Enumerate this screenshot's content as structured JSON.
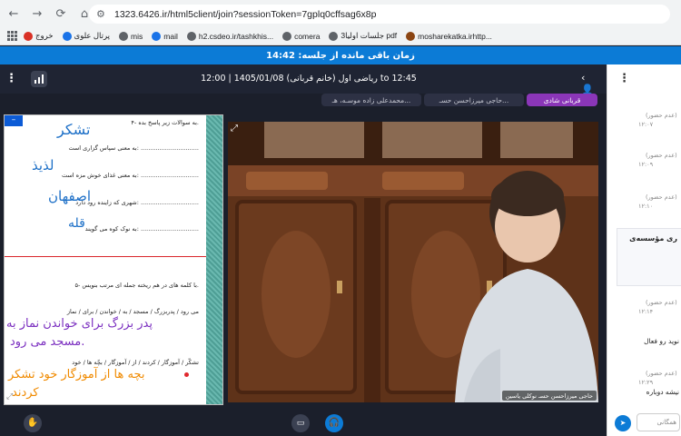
{
  "browser": {
    "url": "1323.6426.ir/html5client/join?sessionToken=7gplq0cffsag6x8p",
    "bookmarks": [
      {
        "label": "خروج",
        "color": "#d93025"
      },
      {
        "label": "پرتال علوی",
        "color": "#1a73e8"
      },
      {
        "label": "mis",
        "color": "#5f6368"
      },
      {
        "label": "mail",
        "color": "#1a73e8"
      },
      {
        "label": "h2.csdeo.ir/tashkhis...",
        "color": "#5f6368"
      },
      {
        "label": "comera",
        "color": "#5f6368"
      },
      {
        "label": "جلسات اولیا3 pdf",
        "color": "#5f6368"
      },
      {
        "label": "mosharekatka.irhttp...",
        "color": "#8b4513"
      }
    ]
  },
  "banner": {
    "text": "زمان باقی مانده از جلسه: 14:42"
  },
  "meeting": {
    "title": "ریاضی اول (خانم قربانی) 1405/01/08 | 12:00 to 12:45"
  },
  "presenters": [
    {
      "label": "قربانی شادی"
    },
    {
      "label": "حاجی میرزاحسن حسـ..."
    },
    {
      "label": "محمدعلی زاده موسـه، هـ..."
    }
  ],
  "slide": {
    "lines": [
      {
        "text": "۴- به سوالات زیر پاسخ بده."
      },
      {
        "text": "به معنی سپاس گزاری است: ..............................."
      },
      {
        "text": "به معنی غذای خوش مزه است: ..............................."
      },
      {
        "text": "شهری که زاینده رود دارد: ..............................."
      },
      {
        "text": "به نوک کوه می گویند: ..............................."
      },
      {
        "text": "۵- با کلمه های در هم ریخته جمله ای مرتب بنویس."
      },
      {
        "text": "می رود / پدربزرگ / مسجد / به / خواندن / برای / نماز"
      },
      {
        "text": "تشکّر / آموزگار / کردند / از / آموزگار / بچّه ها / خود"
      }
    ],
    "handwriting": [
      {
        "text": "تشکر",
        "tone": "blue"
      },
      {
        "text": "لذیذ",
        "tone": "blue"
      },
      {
        "text": "اصفهان",
        "tone": "blue"
      },
      {
        "text": "قله",
        "tone": "blue"
      },
      {
        "text": "پدر بزرگ برای خواندن نماز به",
        "tone": "purple"
      },
      {
        "text": "مسجد می رود.",
        "tone": "purple"
      },
      {
        "text": "بچه ها از آموزگار خود تشکر",
        "tone": "orange"
      },
      {
        "text": "کردند",
        "tone": "orange"
      }
    ]
  },
  "video": {
    "name_tag": "حاجی میرزاحسن حسـ نوکلی یاسین"
  },
  "chat": {
    "messages": [
      {
        "time": "۱۲:۰۷",
        "status": "(عدم حضور)",
        "text": ""
      },
      {
        "time": "۱۲:۰۹",
        "status": "(عدم حضور)",
        "text": ""
      },
      {
        "time": "۱۲:۱۰",
        "status": "(عدم حضور)",
        "text": ""
      },
      {
        "time": "۱۲:۱۴",
        "status": "(عدم حضور)",
        "text": "نوید رو فعال"
      },
      {
        "time": "۱۲:۲۹",
        "status": "(عدم حضور)",
        "text": "نیشه دوباره"
      }
    ],
    "notice": "ری مؤسسه‌ی",
    "input_placeholder": "همگانی"
  }
}
